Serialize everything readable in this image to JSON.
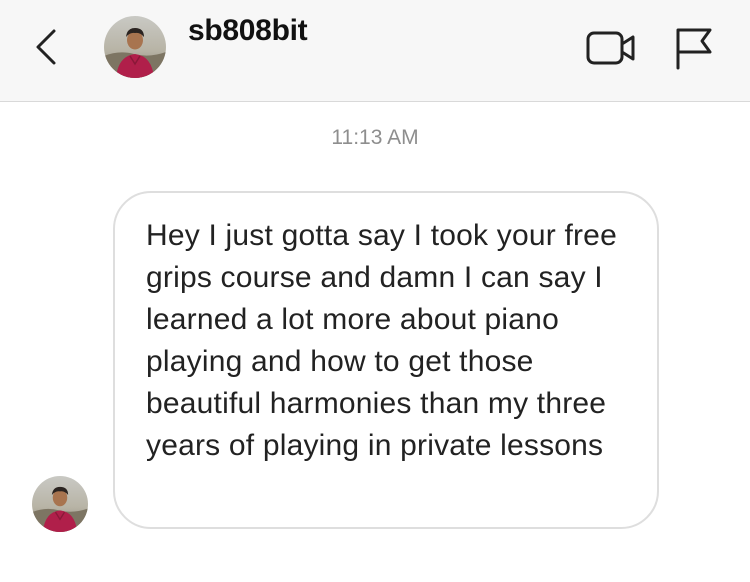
{
  "header": {
    "username": "sb808bit",
    "back_icon": "chevron-left-icon",
    "video_icon": "video-camera-icon",
    "flag_icon": "flag-icon"
  },
  "thread": {
    "timestamp": "11:13 AM",
    "messages": [
      {
        "text": "Hey I just gotta say I took your free grips course and damn I can say I learned a lot more about piano playing and how to get those beautiful harmonies than my three years of playing in private lessons"
      }
    ]
  },
  "colors": {
    "header_bg": "#f7f7f7",
    "bubble_border": "#dedede",
    "timestamp": "#8e8e8e",
    "text": "#222222"
  }
}
